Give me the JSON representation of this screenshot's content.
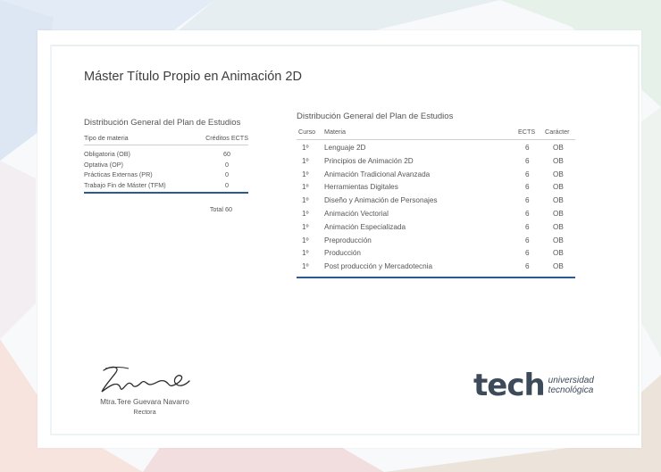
{
  "title": "Máster Título Propio en Animación 2D",
  "summary": {
    "heading": "Distribución General del Plan de Estudios",
    "col_type": "Tipo de materia",
    "col_credits": "Créditos ECTS",
    "rows": [
      {
        "name": "Obligatoria (OB)",
        "value": "60"
      },
      {
        "name": "Optativa (OP)",
        "value": "0"
      },
      {
        "name": "Prácticas Externas (PR)",
        "value": "0"
      },
      {
        "name": "Trabajo Fin de Máster (TFM)",
        "value": "0"
      }
    ],
    "total": "Total 60"
  },
  "detail": {
    "heading": "Distribución General del Plan de Estudios",
    "col_curso": "Curso",
    "col_materia": "Materia",
    "col_ects": "ECTS",
    "col_caracter": "Carácter",
    "rows": [
      {
        "curso": "1º",
        "materia": "Lenguaje 2D",
        "ects": "6",
        "caracter": "OB"
      },
      {
        "curso": "1º",
        "materia": "Principios de Animación 2D",
        "ects": "6",
        "caracter": "OB"
      },
      {
        "curso": "1º",
        "materia": "Animación Tradicional Avanzada",
        "ects": "6",
        "caracter": "OB"
      },
      {
        "curso": "1º",
        "materia": "Herramientas Digitales",
        "ects": "6",
        "caracter": "OB"
      },
      {
        "curso": "1º",
        "materia": "Diseño y Animación de Personajes",
        "ects": "6",
        "caracter": "OB"
      },
      {
        "curso": "1º",
        "materia": "Animación Vectorial",
        "ects": "6",
        "caracter": "OB"
      },
      {
        "curso": "1º",
        "materia": "Animación Especializada",
        "ects": "6",
        "caracter": "OB"
      },
      {
        "curso": "1º",
        "materia": "Preproducción",
        "ects": "6",
        "caracter": "OB"
      },
      {
        "curso": "1º",
        "materia": "Producción",
        "ects": "6",
        "caracter": "OB"
      },
      {
        "curso": "1º",
        "materia": "Post producción y Mercadotecnia",
        "ects": "6",
        "caracter": "OB"
      }
    ]
  },
  "signature": {
    "name": "Mtra.Tere Guevara Navarro",
    "role": "Rectora"
  },
  "logo": {
    "word": "tech",
    "line1": "universidad",
    "line2": "tecnológica"
  }
}
